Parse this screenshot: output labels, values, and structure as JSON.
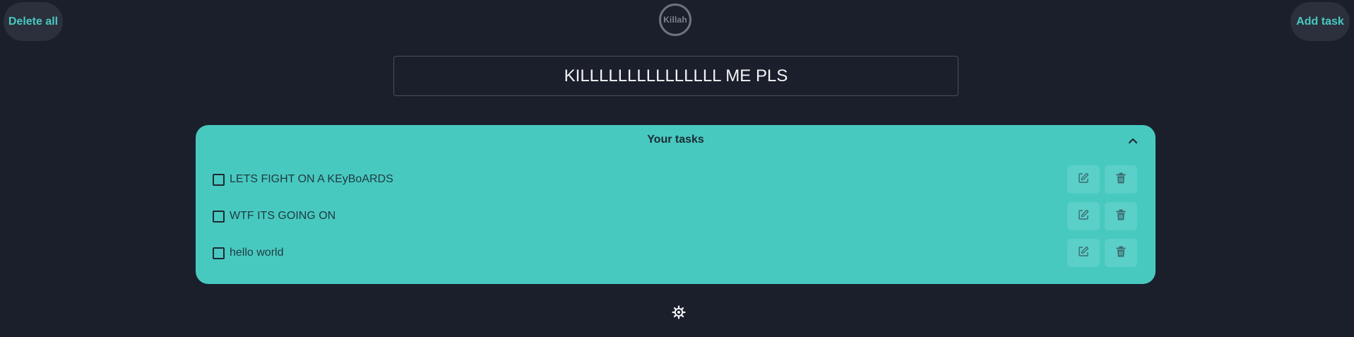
{
  "header": {
    "delete_all_label": "Delete all",
    "add_task_label": "Add task",
    "logo_text": "Killah"
  },
  "title": {
    "text": "KILLLLLLLLLLLLLLL ME PLS"
  },
  "tasks_panel": {
    "heading": "Your tasks",
    "items": [
      {
        "label": "LETS FIGHT ON A KEyBoARDS",
        "checked": false
      },
      {
        "label": "WTF ITS GOING ON",
        "checked": false
      },
      {
        "label": "hello world",
        "checked": false
      }
    ]
  },
  "icons": {
    "collapse": "chevron-up-icon",
    "edit": "edit-icon",
    "delete": "trash-icon",
    "settings": "gear-icon"
  },
  "colors": {
    "background": "#1b1f2b",
    "accent": "#48c9c0",
    "corner_button_bg": "#2b303c"
  }
}
